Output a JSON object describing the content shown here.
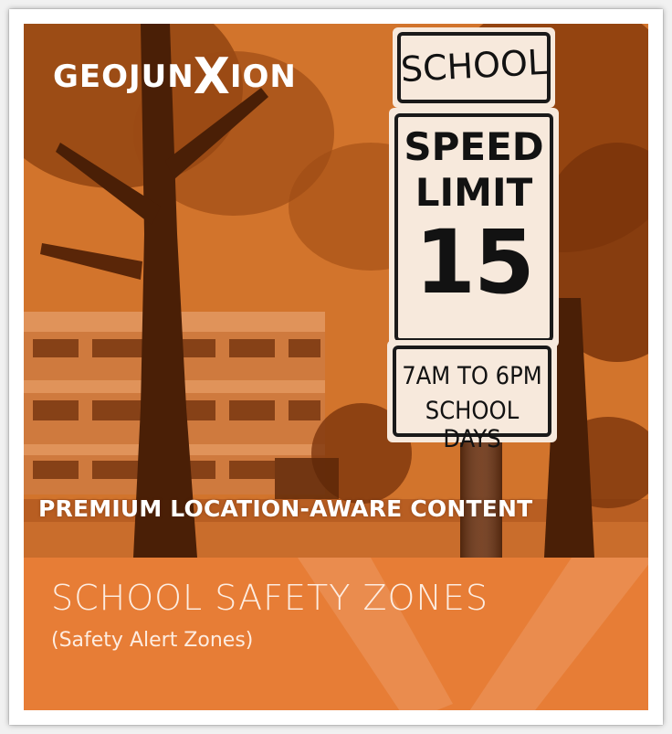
{
  "logo": {
    "prefix": "GEOJUN",
    "x": "X",
    "suffix": "ION"
  },
  "sign": {
    "top": "SCHOOL",
    "line1": "SPEED",
    "line2": "LIMIT",
    "number": "15",
    "hours": "7AM TO 6PM",
    "days": "SCHOOL DAYS"
  },
  "headline": "PREMIUM LOCATION-AWARE CONTENT",
  "banner": {
    "title": "SCHOOL SAFETY ZONES",
    "subtitle": "(Safety Alert Zones)"
  },
  "colors": {
    "brand_orange": "#e77d36",
    "photo_tint": "#d0702a"
  }
}
